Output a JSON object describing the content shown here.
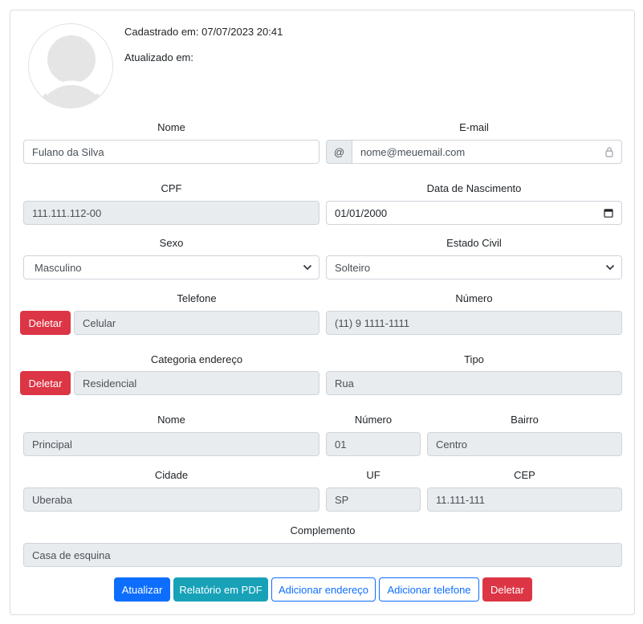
{
  "header": {
    "created_label": "Cadastrado em: 07/07/2023 20:41",
    "updated_label": "Atualizado em:"
  },
  "icons": {
    "avatar": "user-silhouette-icon",
    "email_lock": "lock-icon",
    "calendar": "calendar-icon",
    "select_arrow": "chevron-down-icon"
  },
  "form": {
    "nome": {
      "label": "Nome",
      "value": "Fulano da Silva"
    },
    "email": {
      "label": "E-mail",
      "addon": "@",
      "value": "nome@meuemail.com"
    },
    "cpf": {
      "label": "CPF",
      "value": "111.111.112-00"
    },
    "nascimento": {
      "label": "Data de Nascimento",
      "value": "01/01/2000"
    },
    "sexo": {
      "label": "Sexo",
      "value": "Masculino"
    },
    "estado_civil": {
      "label": "Estado Civil",
      "value": "Solteiro"
    }
  },
  "telefone": {
    "label": "Telefone",
    "delete_label": "Deletar",
    "tipo": "Celular",
    "numero_label": "Número",
    "numero": "(11) 9 1111-1111"
  },
  "endereco": {
    "categoria_label": "Categoria endereço",
    "delete_label": "Deletar",
    "categoria": "Residencial",
    "tipo_label": "Tipo",
    "tipo": "Rua",
    "nome_label": "Nome",
    "nome": "Principal",
    "numero_label": "Número",
    "numero": "01",
    "bairro_label": "Bairro",
    "bairro": "Centro",
    "cidade_label": "Cidade",
    "cidade": "Uberaba",
    "uf_label": "UF",
    "uf": "SP",
    "cep_label": "CEP",
    "cep": "11.111-111",
    "complemento_label": "Complemento",
    "complemento": "Casa de esquina"
  },
  "actions": {
    "atualizar": "Atualizar",
    "relatorio": "Relatório em PDF",
    "add_endereco": "Adicionar endereço",
    "add_telefone": "Adicionar telefone",
    "deletar": "Deletar"
  },
  "colors": {
    "primary": "#0d6efd",
    "danger": "#dc3545",
    "info": "#17a2b8",
    "readonly_bg": "#e9ecef",
    "border": "#ced4da"
  }
}
